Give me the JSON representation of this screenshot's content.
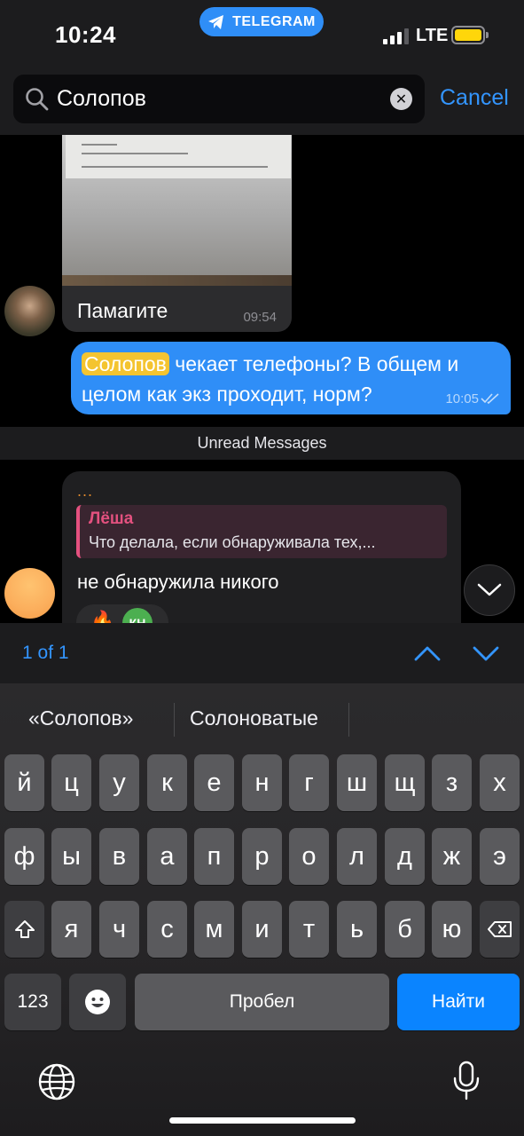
{
  "status_bar": {
    "time": "10:24",
    "app_pill": "TELEGRAM",
    "network": "LTE"
  },
  "search": {
    "query": "Солопов",
    "cancel_label": "Cancel"
  },
  "messages": {
    "photo_message": {
      "caption": "Памагите",
      "time": "09:54"
    },
    "outgoing": {
      "highlight": "Солопов",
      "text_rest": " чекает телефоны? В общем и целом как экз проходит, норм?",
      "time": "10:05"
    },
    "unread_label": "Unread Messages",
    "incoming": {
      "dots": "...",
      "reply_name": "Лёша",
      "reply_text": "Что делала, если обнаруживала тех,...",
      "text": "не обнаружила никого",
      "reaction_emoji": "🔥",
      "reaction_avatar": "КН"
    }
  },
  "result_nav": {
    "count": "1 of 1"
  },
  "keyboard": {
    "suggestions": [
      "«Солопов»",
      "Солоноватые"
    ],
    "row1": [
      "й",
      "ц",
      "у",
      "к",
      "е",
      "н",
      "г",
      "ш",
      "щ",
      "з",
      "х"
    ],
    "row2": [
      "ф",
      "ы",
      "в",
      "а",
      "п",
      "р",
      "о",
      "л",
      "д",
      "ж",
      "э"
    ],
    "row3": [
      "я",
      "ч",
      "с",
      "м",
      "и",
      "т",
      "ь",
      "б",
      "ю"
    ],
    "numbers_label": "123",
    "space_label": "Пробел",
    "search_label": "Найти"
  },
  "colors": {
    "accent": "#2f8ef7",
    "highlight": "#f4c430",
    "reply_name": "#e4517f"
  }
}
